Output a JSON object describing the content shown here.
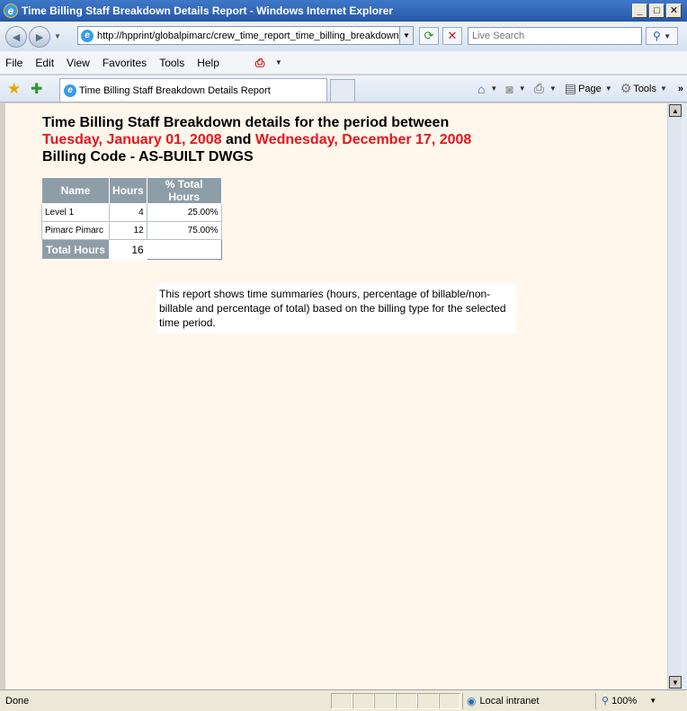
{
  "window": {
    "title": "Time Billing Staff Breakdown Details Report - Windows Internet Explorer",
    "controls": {
      "minimize": "_",
      "maximize": "□",
      "close": "✕"
    }
  },
  "address_bar": {
    "url": "http://hpprint/globalpimarc/crew_time_report_time_billing_breakdown_",
    "search_placeholder": "Live Search"
  },
  "menu": {
    "items": [
      "File",
      "Edit",
      "View",
      "Favorites",
      "Tools",
      "Help"
    ]
  },
  "tabs": {
    "active_label": "Time Billing Staff Breakdown Details Report"
  },
  "command_bar": {
    "page_label": "Page",
    "tools_label": "Tools",
    "overflow": "»"
  },
  "report": {
    "heading_line1": "Time Billing Staff Breakdown details for the period between",
    "start_date": "Tuesday, January 01, 2008",
    "connector": " and ",
    "end_date": "Wednesday, December 17, 2008",
    "billing_code": "Billing Code - AS-BUILT DWGS",
    "table": {
      "headers": [
        "Name",
        "Hours",
        "% Total Hours"
      ],
      "rows": [
        {
          "name": "Level 1",
          "hours": "4",
          "percent": "25.00%"
        },
        {
          "name": "Pimarc Pimarc",
          "hours": "12",
          "percent": "75.00%"
        }
      ],
      "total_label": "Total Hours",
      "total_value": "16"
    },
    "note": "This report shows time summaries (hours, percentage of billable/non-billable and percentage of total) based on the billing type for the selected time period."
  },
  "status_bar": {
    "status": "Done",
    "zone": "Local intranet",
    "zoom": "100%"
  },
  "colors": {
    "date_red": "#e8141e",
    "header_gray": "#8e9ea8",
    "content_bg": "#fff7ec"
  }
}
